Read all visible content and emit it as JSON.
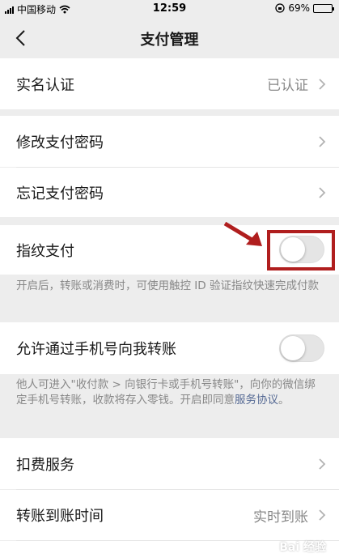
{
  "status_bar": {
    "carrier": "中国移动",
    "time": "12:59",
    "battery": "69%",
    "battery_level": 0.69
  },
  "nav": {
    "title": "支付管理"
  },
  "cells": {
    "real_name": {
      "label": "实名认证",
      "value": "已认证"
    },
    "change_pwd": {
      "label": "修改支付密码"
    },
    "forgot_pwd": {
      "label": "忘记支付密码"
    },
    "fingerprint": {
      "label": "指纹支付",
      "enabled": false
    },
    "phone_transfer": {
      "label": "允许通过手机号向我转账",
      "enabled": false
    },
    "deduction": {
      "label": "扣费服务"
    },
    "arrival_time": {
      "label": "转账到账时间",
      "value": "实时到账"
    }
  },
  "notes": {
    "fingerprint": "开启后，转账或消费时，可使用触控 ID 验证指纹快速完成付款",
    "phone_transfer_text": "他人可进入\"收付款 > 向银行卡或手机号转账\"，向你的微信绑定手机号转账，收款将存入零钱。开启即同意",
    "phone_transfer_link": "服务协议",
    "phone_transfer_end": "。"
  },
  "watermark": "Bai 经验",
  "colors": {
    "background": "#ededed",
    "link": "#576b95",
    "annotation": "#b01e1e",
    "battery": "#f5c518"
  }
}
